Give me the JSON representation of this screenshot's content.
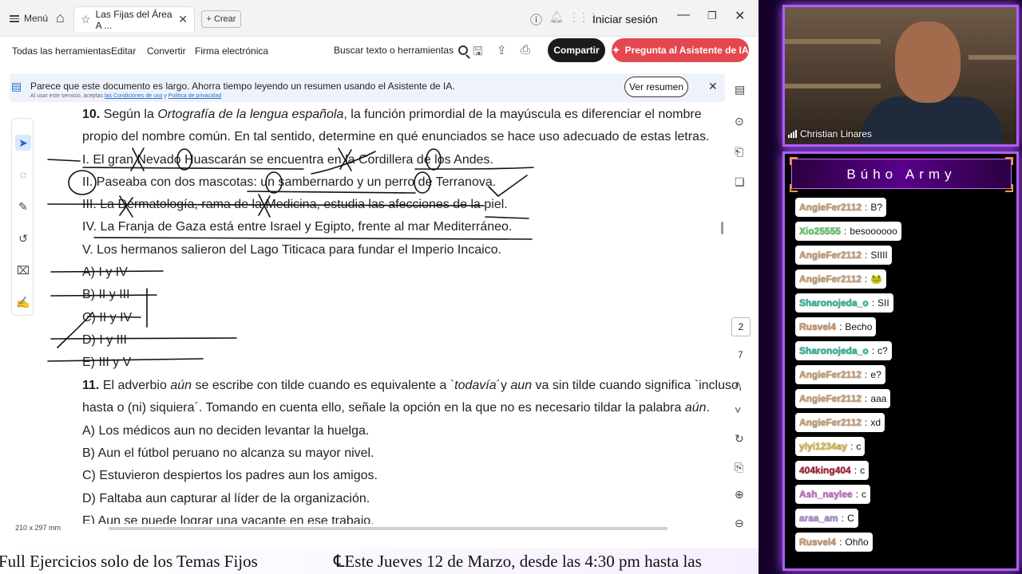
{
  "titlebar": {
    "menu_label": "Menú",
    "tab_title": "Las Fijas del Área A ...",
    "new_tab_label": "Crear",
    "sign_in": "Iniciar sesión"
  },
  "toolbar": {
    "all_tools": "Todas las herramientas",
    "edit": "Editar",
    "convert": "Convertir",
    "esign": "Firma electrónica",
    "search": "Buscar texto o herramientas",
    "share": "Compartir",
    "ai_assistant": "Pregunta al Asistente de IA"
  },
  "banner": {
    "text": "Parece que este documento es largo. Ahorra tiempo leyendo un resumen usando el Asistente de IA.",
    "small_prefix": "Al usar este servicio, aceptas",
    "terms_link": "las Condiciones de uso",
    "and": "y",
    "privacy_link": "Política de privacidad",
    "summary_button": "Ver resumen"
  },
  "document": {
    "q10_number": "10.",
    "q10_line1_a": "Según la",
    "q10_line1_italic": "Ortografía de la lengua española",
    "q10_line1_b": ", la función primordial de la mayúscula es diferenciar el nombre",
    "q10_line2": "propio del nombre común. En tal sentido, determine en qué enunciados se hace uso adecuado de estas letras.",
    "q10_items": [
      "I. El gran Nevado Huascarán se encuentra en la Cordillera de los Andes.",
      "II. Paseaba con dos mascotas: un sambernardo y un perro de Terranova.",
      "III. La Dermatología, rama de la Medicina, estudia las afecciones de la piel.",
      "IV. La Franja de Gaza está entre Israel y Egipto, frente al mar Mediterráneo.",
      "V. Los hermanos salieron del Lago Titicaca para fundar el Imperio Incaico."
    ],
    "q10_options": [
      "A) I y IV",
      "B) II y III",
      "C) II y IV",
      "D) I y III",
      "E) III y V"
    ],
    "q11_number": "11.",
    "q11_line1_a": "El adverbio",
    "q11_line1_i1": "aún",
    "q11_line1_b": "se escribe con tilde cuando es equivalente a `",
    "q11_line1_i2": "todavía",
    "q11_line1_c": "´y",
    "q11_line1_i3": "aun",
    "q11_line1_d": "va sin tilde cuando significa `incluso,",
    "q11_line2_a": "hasta o (ni) siquiera´. Tomando en cuenta ello, señale la opción en la que no es necesario tildar la palabra",
    "q11_line2_i": "aún",
    "q11_line2_b": ".",
    "q11_options": [
      "A) Los médicos aun no deciden levantar la huelga.",
      "B) Aun el fútbol peruano no alcanza su mayor nivel.",
      "C) Estuvieron despiertos los padres aun los amigos.",
      "D) Faltaba aun capturar al líder de la organización.",
      "E) Aun se puede lograr una vacante en ese trabajo."
    ]
  },
  "status": {
    "page_dimensions": "210 x 297 mm",
    "current_page": "2",
    "total_pages": "7"
  },
  "ticker": {
    "left": "Full Ejercicios solo de los Temas Fijos",
    "right": "℄Este Jueves 12 de Marzo, desde las 4:30 pm hasta las"
  },
  "webcam": {
    "name": "Christian Linares"
  },
  "chat": {
    "title": "Búho Army",
    "messages": [
      {
        "user": "AngieFer2112",
        "text": "B?",
        "color": "#d4a373"
      },
      {
        "user": "Xio25555",
        "text": "besoooooo",
        "color": "#5fd35f"
      },
      {
        "user": "AngieFer2112",
        "text": "SIIII",
        "color": "#d4a373"
      },
      {
        "user": "AngieFer2112",
        "text": "🐸",
        "color": "#d4a373"
      },
      {
        "user": "Sharonojeda_o",
        "text": "SII",
        "color": "#20c0a0"
      },
      {
        "user": "Rusvel4",
        "text": "Becho",
        "color": "#d49a6a"
      },
      {
        "user": "Sharonojeda_o",
        "text": "c?",
        "color": "#20c0a0"
      },
      {
        "user": "AngieFer2112",
        "text": "e?",
        "color": "#d4a373"
      },
      {
        "user": "AngieFer2112",
        "text": "aaa",
        "color": "#d4a373"
      },
      {
        "user": "AngieFer2112",
        "text": "xd",
        "color": "#d4a373"
      },
      {
        "user": "ylyi1234ay",
        "text": "c",
        "color": "#e0c040"
      },
      {
        "user": "404king404",
        "text": "c",
        "color": "#b0203a"
      },
      {
        "user": "Ash_naylee",
        "text": "c",
        "color": "#d070d0"
      },
      {
        "user": "araa_am",
        "text": "C",
        "color": "#b090e0"
      },
      {
        "user": "Rusvel4",
        "text": "Ohño",
        "color": "#d49a6a"
      }
    ]
  }
}
